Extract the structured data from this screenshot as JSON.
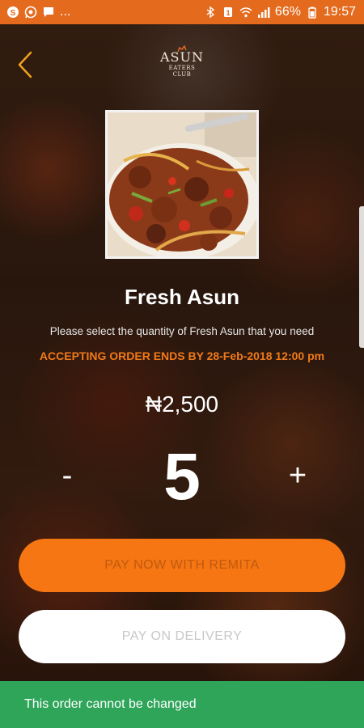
{
  "status_bar": {
    "left_icons": [
      "skype-icon",
      "whatsapp-icon",
      "message-icon"
    ],
    "more": "...",
    "battery": "66%",
    "time": "19:57"
  },
  "header": {
    "logo_line1": "ASUN",
    "logo_line2": "EATERS CLUB"
  },
  "product": {
    "name": "Fresh Asun",
    "instruction": "Please select the quantity of Fresh Asun that you need",
    "deadline": "ACCEPTING ORDER ENDS BY 28-Feb-2018 12:00 pm",
    "price": "₦2,500"
  },
  "quantity": {
    "decrement_label": "-",
    "value": "5",
    "increment_label": "+"
  },
  "actions": {
    "pay_now_label": "PAY NOW WITH REMITA",
    "pay_delivery_label": "PAY ON DELIVERY"
  },
  "banner": {
    "message": "This order cannot be changed"
  },
  "colors": {
    "status_bar": "#e46b1e",
    "accent_orange": "#f57612",
    "banner_green": "#2fa55a"
  }
}
